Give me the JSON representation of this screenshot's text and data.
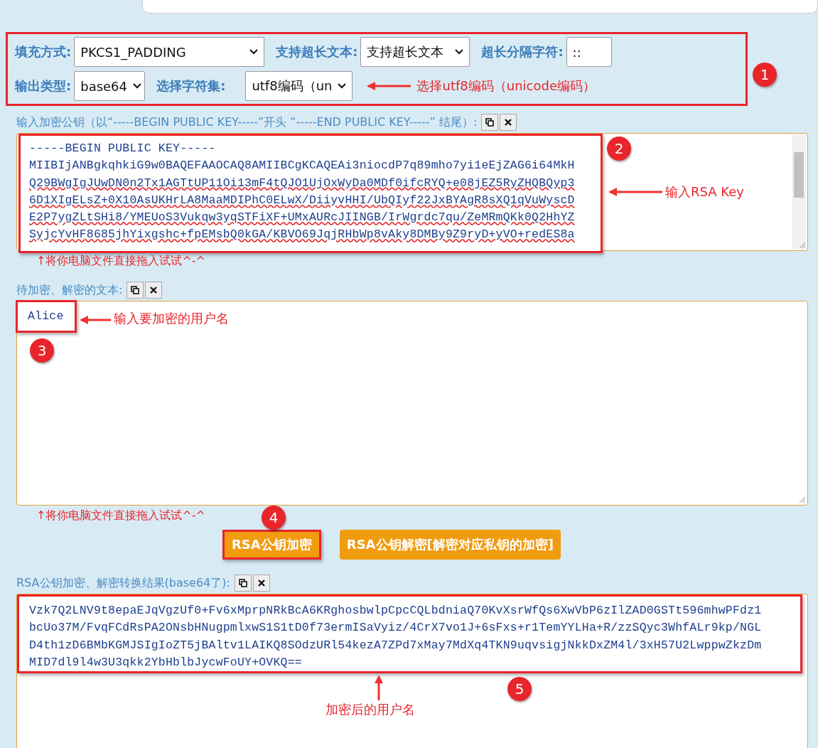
{
  "options": {
    "fields": [
      {
        "label": "填充方式:",
        "kind": "select",
        "value": "PKCS1_PADDING"
      },
      {
        "label": "支持超长文本:",
        "kind": "select",
        "value": "支持超长文本"
      },
      {
        "label": "超长分隔字符:",
        "kind": "input",
        "value": "::"
      },
      {
        "label": "输出类型:",
        "kind": "select",
        "value": "base64"
      },
      {
        "label": "选择字符集:",
        "kind": "select",
        "value": "utf8编码（un"
      }
    ],
    "annotation": {
      "badge": "1",
      "note": "选择utf8编码（unicode编码）"
    }
  },
  "key": {
    "label": "输入加密公钥（以“-----BEGIN PUBLIC KEY-----”开头 “-----END PUBLIC KEY-----” 结尾）:",
    "lines": [
      {
        "text": "-----BEGIN PUBLIC KEY-----",
        "flagged": false
      },
      {
        "text": "MIIBIjANBgkqhkiG9w0BAQEFAAOCAQ8AMIIBCgKCAQEAi3niocdP7q89mho7yi1eEjZAG6i64MkH",
        "flagged": false
      },
      {
        "text": "Q29BWgIgJUwDN0n2Tx1AGTtUP11Oi13mF4tQJO1UjOxWyDa0MDf0ifcRYQ+e08jEZ5RyZHQBQyp3",
        "flagged": true
      },
      {
        "text": "6D1XIgELsZ+0X10AsUKHrLA8MaaMDIPhC0ELwX/DiiyvHHI/UbQIyf22JxBYAgR8sXQ1qVuWyscD",
        "flagged": true
      },
      {
        "text": "E2P7ygZLtSHi8/YMEUoS3Vukqw3yqSTFiXF+UMxAURcJIINGB/IrWgrdc7qu/ZeMRmQKk0Q2HhYZ",
        "flagged": true
      },
      {
        "text": "SyjcYvHF8685jhYixgshc+fpEMsbQ0kGA/KBVO69JqjRHbWp8vAky8DMBy9Z9ryD+yVO+redES8a",
        "flagged": true
      }
    ],
    "drop_hint": "↑将你电脑文件直接拖入试试^-^",
    "annotation": {
      "badge": "2",
      "note": "输入RSA Key"
    }
  },
  "plaintext": {
    "label": "待加密、解密的文本:",
    "value": "Alice",
    "drop_hint": "↑将你电脑文件直接拖入试试^-^",
    "annotation": {
      "badge": "3",
      "note": "输入要加密的用户名"
    }
  },
  "buttons": [
    {
      "label": "RSA公钥加密",
      "highlighted": true,
      "badge": "4"
    },
    {
      "label": "RSA公钥解密[解密对应私钥的加密]",
      "highlighted": false
    }
  ],
  "result": {
    "label": "RSA公钥加密、解密转换结果(base64了):",
    "lines": [
      "Vzk7Q2LNV9t8epaEJqVgzUf0+Fv6xMprpNRkBcA6KRghosbwlpCpcCQLbdniaQ70KvXsrWfQs6XwVbP6zIlZAD0GSTt596mhwPFdz1",
      "bcUo37M/FvqFCdRsPA2ONsbHNugpmlxwS1S1tD0f73ermISaVyiz/4CrX7vo1J+6sFxs+r1TemYYLHa+R/zzSQyc3WhfALr9kp/NGL",
      "D4th1zD6BMbKGMJSIgIoZT5jBAltv1LAIKQ8SOdzURl54kezA7ZPd7xMay7MdXq4TKN9uqvsigjNkkDxZM4l/3xH57U2LwppwZkzDm",
      "MID7dl9l4w3U3qkk2YbHblbJycwFoUY+OVKQ=="
    ],
    "annotation": {
      "badge": "5",
      "note": "加密后的用户名"
    }
  }
}
